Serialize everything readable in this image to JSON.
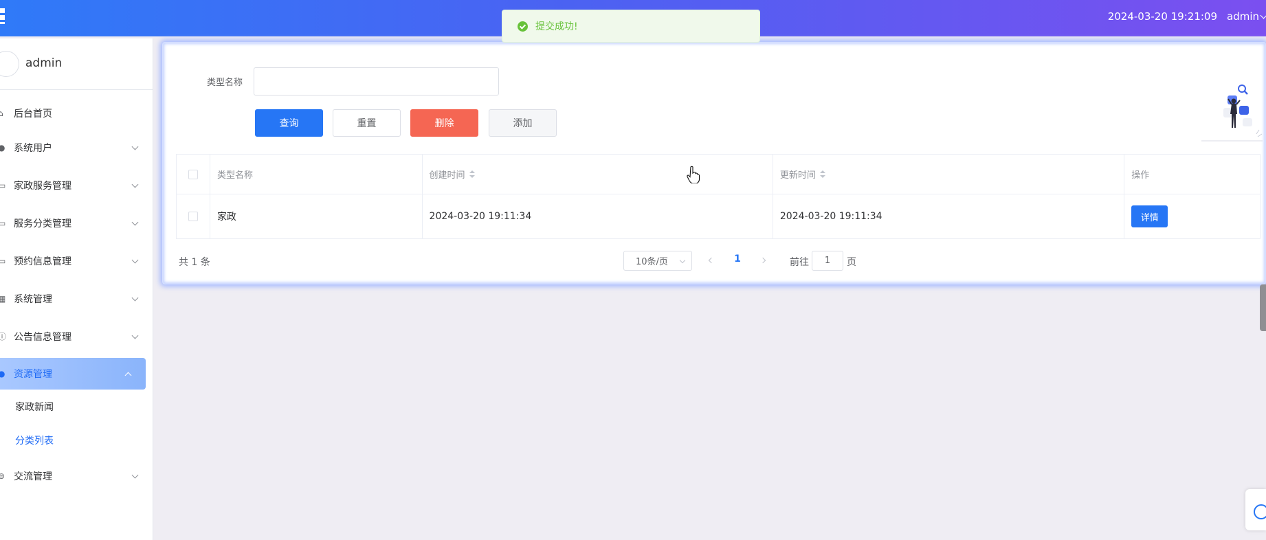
{
  "header": {
    "datetime": "2024-03-20 19:21:09",
    "user": "admin",
    "icon": "grid-menu-icon"
  },
  "toast": {
    "message": "提交成功!",
    "icon": "success-check-icon",
    "color": "#67c23a"
  },
  "sidebar": {
    "profile_name": "admin",
    "items": [
      {
        "label": "后台首页",
        "icon": "home-icon",
        "expandable": false
      },
      {
        "label": "系统用户",
        "icon": "user-icon",
        "expandable": true
      },
      {
        "label": "家政服务管理",
        "icon": "folder-icon",
        "expandable": true
      },
      {
        "label": "服务分类管理",
        "icon": "folder-icon",
        "expandable": true
      },
      {
        "label": "预约信息管理",
        "icon": "folder-icon",
        "expandable": true
      },
      {
        "label": "系统管理",
        "icon": "chart-icon",
        "expandable": true
      },
      {
        "label": "公告信息管理",
        "icon": "info-icon",
        "expandable": true
      },
      {
        "label": "资源管理",
        "icon": "bulb-icon",
        "expandable": true,
        "active": true
      },
      {
        "label": "交流管理",
        "icon": "chat-icon",
        "expandable": true
      }
    ],
    "submenu": [
      {
        "label": "家政新闻"
      },
      {
        "label": "分类列表",
        "current": true
      }
    ]
  },
  "search": {
    "label": "类型名称",
    "value": ""
  },
  "buttons": {
    "query": "查询",
    "reset": "重置",
    "delete": "删除",
    "add": "添加"
  },
  "table": {
    "columns": [
      "类型名称",
      "创建时间",
      "更新时间",
      "操作"
    ],
    "rows": [
      {
        "name": "家政",
        "created": "2024-03-20 19:11:34",
        "updated": "2024-03-20 19:11:34",
        "action": "详情"
      }
    ]
  },
  "pagination": {
    "total": "共 1 条",
    "page_size": "10条/页",
    "current_page": "1",
    "goto_label": "前往",
    "goto_value": "1",
    "goto_suffix": "页"
  },
  "colors": {
    "primary": "#2676f5",
    "danger": "#f56653",
    "header_start": "#2f7af8",
    "header_end": "#7b4ff0"
  }
}
